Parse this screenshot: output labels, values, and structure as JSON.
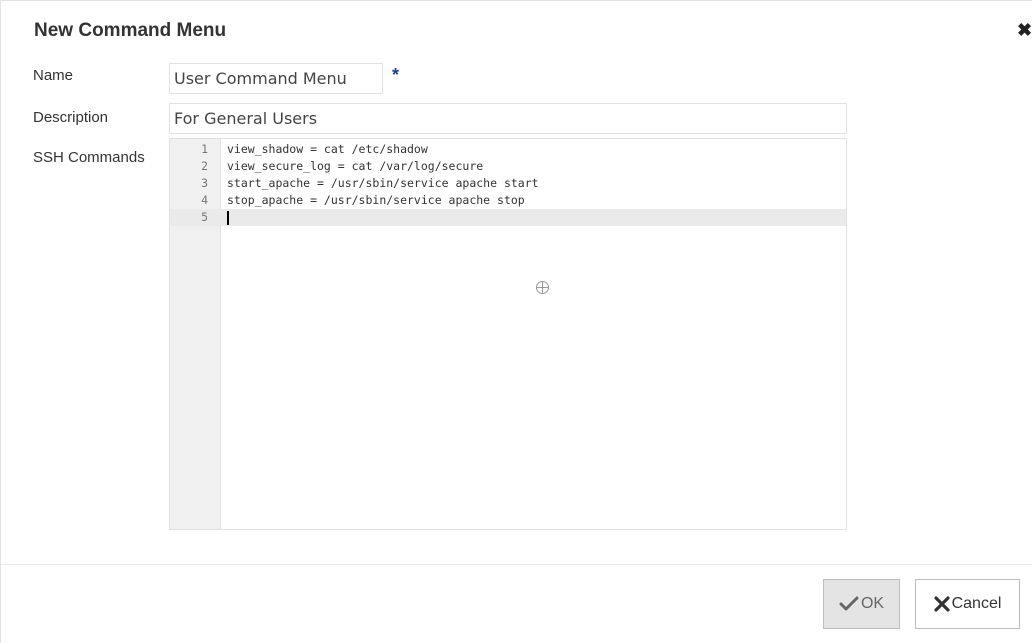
{
  "dialog": {
    "title": "New Command Menu",
    "close_icon": "close-icon"
  },
  "form": {
    "name_label": "Name",
    "name_value": "User Command Menu",
    "required_marker": "*",
    "description_label": "Description",
    "description_value": "For General Users",
    "ssh_label": "SSH Commands"
  },
  "editor": {
    "lines": [
      {
        "num": "1",
        "text": "view_shadow = cat /etc/shadow"
      },
      {
        "num": "2",
        "text": "view_secure_log = cat /var/log/secure"
      },
      {
        "num": "3",
        "text": "start_apache = /usr/sbin/service apache start"
      },
      {
        "num": "4",
        "text": "stop_apache = /usr/sbin/service apache stop"
      },
      {
        "num": "5",
        "text": ""
      }
    ],
    "active_line": 5
  },
  "footer": {
    "ok_label": "OK",
    "cancel_label": "Cancel",
    "ok_icon": "check-icon",
    "cancel_icon": "x-icon"
  },
  "colors": {
    "required": "#1e3f8a",
    "ok_bg": "#e4e4e4"
  }
}
